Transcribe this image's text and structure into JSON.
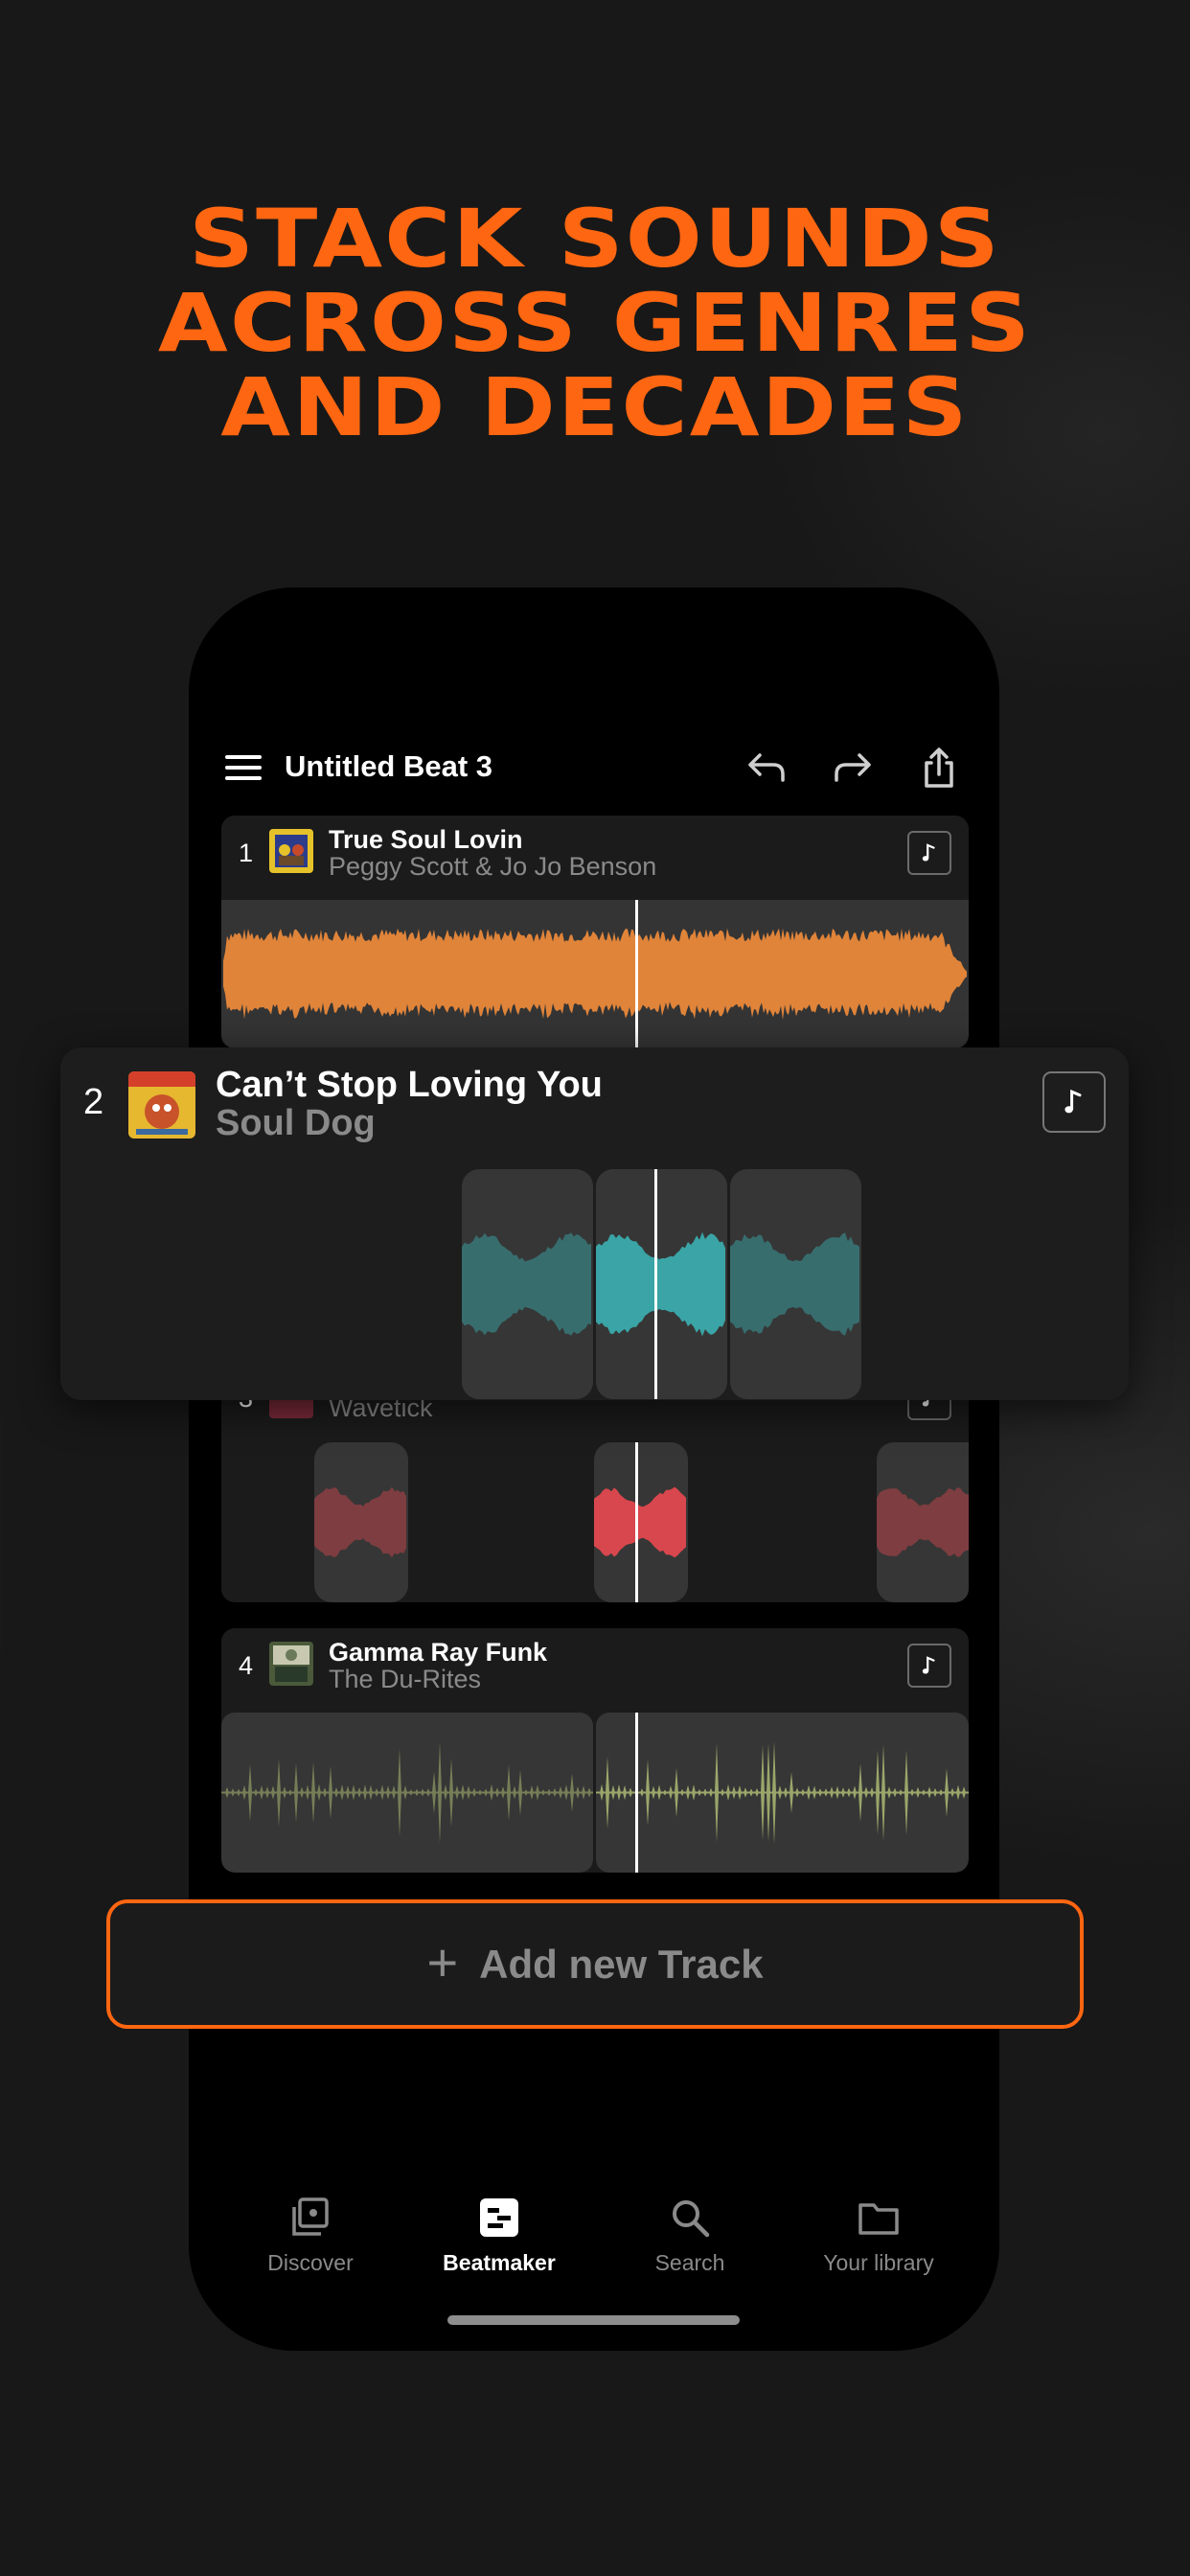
{
  "headline": {
    "line1": "STACK SOUNDS",
    "line2": "ACROSS GENRES",
    "line3": "AND DECADES",
    "color": "#ff6611"
  },
  "header": {
    "title": "Untitled Beat 3",
    "icons": [
      "menu-icon",
      "undo-icon",
      "redo-icon",
      "share-icon"
    ]
  },
  "tracks": [
    {
      "number": "1",
      "title": "True Soul Lovin",
      "artist": "Peggy Scott & Jo Jo Benson",
      "color": "#e0843a"
    },
    {
      "number": "2",
      "title": "Can’t Stop Loving You",
      "artist": "Soul Dog",
      "color": "#3aa4a6"
    },
    {
      "number": "3",
      "title": "",
      "artist": "Wavetick",
      "color": "#d8474d"
    },
    {
      "number": "4",
      "title": "Gamma Ray Funk",
      "artist": "The Du-Rites",
      "color": "#9aa66a"
    }
  ],
  "add_track": {
    "label": "Add new Track",
    "border_color": "#ff6611"
  },
  "nav": {
    "items": [
      {
        "label": "Discover",
        "icon": "discover-icon",
        "active": false
      },
      {
        "label": "Beatmaker",
        "icon": "beatmaker-icon",
        "active": true
      },
      {
        "label": "Search",
        "icon": "search-icon",
        "active": false
      },
      {
        "label": "Your library",
        "icon": "folder-icon",
        "active": false
      }
    ]
  }
}
